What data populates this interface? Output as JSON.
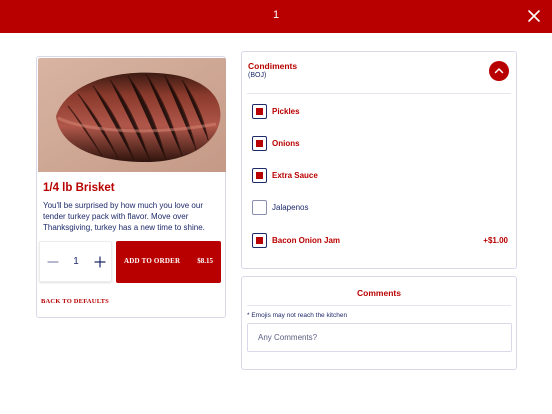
{
  "header": {
    "title": "1",
    "close_icon": "close-icon"
  },
  "item": {
    "name": "1/4 lb Brisket",
    "description": "You'll be surprised by how much you love our tender turkey pack with flavor. Move over Thanksgiving, turkey has a new time to shine.",
    "image": "brisket-photo",
    "quantity": "1",
    "add_label": "ADD TO ORDER",
    "price": "$8.15",
    "back_label": "BACK TO DEFAULTS"
  },
  "condiments": {
    "title": "Condiments",
    "subtitle": "(BOJ)",
    "collapse_icon": "chevron-up-icon",
    "options": [
      {
        "label": "Pickles",
        "checked": true,
        "price": ""
      },
      {
        "label": "Onions",
        "checked": true,
        "price": ""
      },
      {
        "label": "Extra Sauce",
        "checked": true,
        "price": ""
      },
      {
        "label": "Jalapenos",
        "checked": false,
        "price": ""
      },
      {
        "label": "Bacon Onion Jam",
        "checked": true,
        "price": "+$1.00"
      }
    ]
  },
  "comments": {
    "title": "Comments",
    "note": "* Emojis may not reach the kitchen",
    "placeholder": "Any Comments?"
  },
  "colors": {
    "brand": "#b90000",
    "text": "#1e2a6a"
  }
}
